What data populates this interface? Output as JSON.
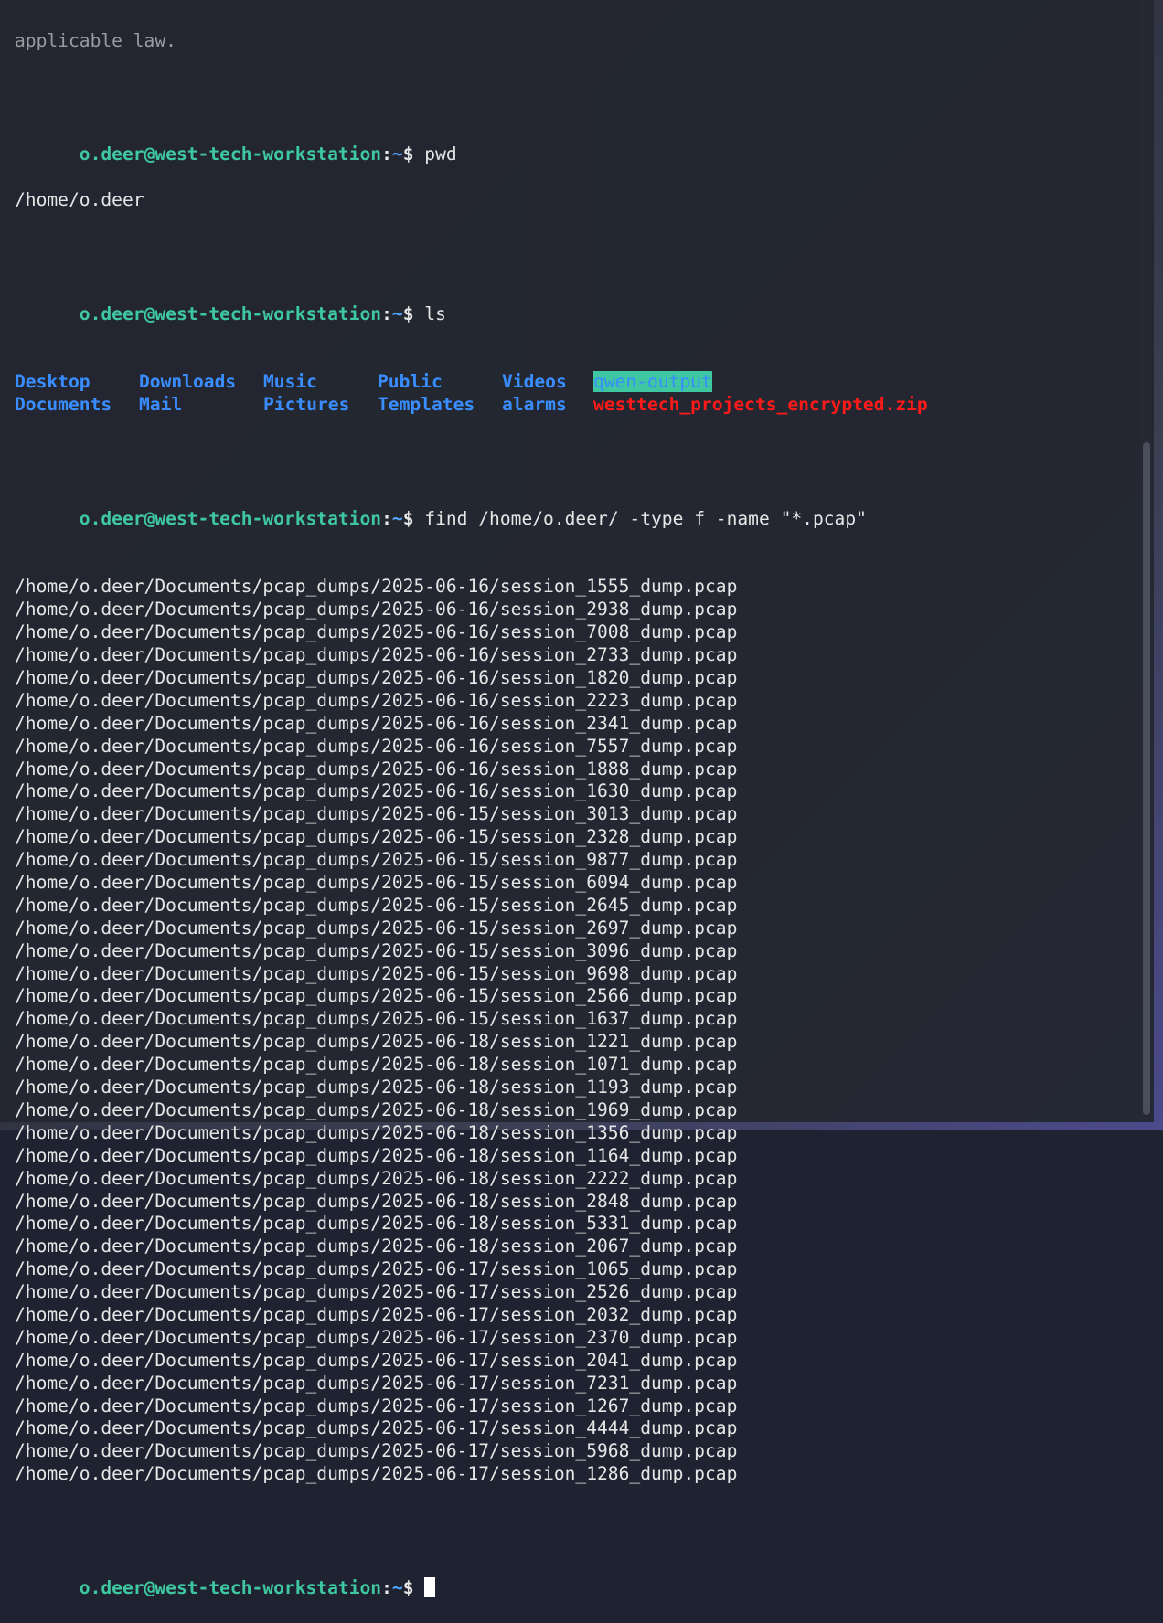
{
  "prompt": {
    "user": "o.deer",
    "at": "@",
    "host": "west-tech-workstation",
    "colon": ":",
    "path": "~",
    "dollar": "$"
  },
  "top_line": "applicable law.",
  "commands": {
    "pwd": " pwd",
    "pwd_output": "/home/o.deer",
    "ls": " ls",
    "find": " find /home/o.deer/ -type f -name \"*.pcap\""
  },
  "ls_output": [
    {
      "name": "Desktop",
      "kind": "dir"
    },
    {
      "name": "Downloads",
      "kind": "dir"
    },
    {
      "name": "Music",
      "kind": "dir"
    },
    {
      "name": "Public",
      "kind": "dir"
    },
    {
      "name": "Videos",
      "kind": "dir"
    },
    {
      "name": "qwen-output",
      "kind": "hl-dir"
    },
    {
      "name": "Documents",
      "kind": "dir"
    },
    {
      "name": "Mail",
      "kind": "dir"
    },
    {
      "name": "Pictures",
      "kind": "dir"
    },
    {
      "name": "Templates",
      "kind": "dir"
    },
    {
      "name": "alarms",
      "kind": "dir"
    },
    {
      "name": "westtech_projects_encrypted.zip",
      "kind": "zip"
    }
  ],
  "find_results": [
    "/home/o.deer/Documents/pcap_dumps/2025-06-16/session_1555_dump.pcap",
    "/home/o.deer/Documents/pcap_dumps/2025-06-16/session_2938_dump.pcap",
    "/home/o.deer/Documents/pcap_dumps/2025-06-16/session_7008_dump.pcap",
    "/home/o.deer/Documents/pcap_dumps/2025-06-16/session_2733_dump.pcap",
    "/home/o.deer/Documents/pcap_dumps/2025-06-16/session_1820_dump.pcap",
    "/home/o.deer/Documents/pcap_dumps/2025-06-16/session_2223_dump.pcap",
    "/home/o.deer/Documents/pcap_dumps/2025-06-16/session_2341_dump.pcap",
    "/home/o.deer/Documents/pcap_dumps/2025-06-16/session_7557_dump.pcap",
    "/home/o.deer/Documents/pcap_dumps/2025-06-16/session_1888_dump.pcap",
    "/home/o.deer/Documents/pcap_dumps/2025-06-16/session_1630_dump.pcap",
    "/home/o.deer/Documents/pcap_dumps/2025-06-15/session_3013_dump.pcap",
    "/home/o.deer/Documents/pcap_dumps/2025-06-15/session_2328_dump.pcap",
    "/home/o.deer/Documents/pcap_dumps/2025-06-15/session_9877_dump.pcap",
    "/home/o.deer/Documents/pcap_dumps/2025-06-15/session_6094_dump.pcap",
    "/home/o.deer/Documents/pcap_dumps/2025-06-15/session_2645_dump.pcap",
    "/home/o.deer/Documents/pcap_dumps/2025-06-15/session_2697_dump.pcap",
    "/home/o.deer/Documents/pcap_dumps/2025-06-15/session_3096_dump.pcap",
    "/home/o.deer/Documents/pcap_dumps/2025-06-15/session_9698_dump.pcap",
    "/home/o.deer/Documents/pcap_dumps/2025-06-15/session_2566_dump.pcap",
    "/home/o.deer/Documents/pcap_dumps/2025-06-15/session_1637_dump.pcap",
    "/home/o.deer/Documents/pcap_dumps/2025-06-18/session_1221_dump.pcap",
    "/home/o.deer/Documents/pcap_dumps/2025-06-18/session_1071_dump.pcap",
    "/home/o.deer/Documents/pcap_dumps/2025-06-18/session_1193_dump.pcap",
    "/home/o.deer/Documents/pcap_dumps/2025-06-18/session_1969_dump.pcap",
    "/home/o.deer/Documents/pcap_dumps/2025-06-18/session_1356_dump.pcap",
    "/home/o.deer/Documents/pcap_dumps/2025-06-18/session_1164_dump.pcap",
    "/home/o.deer/Documents/pcap_dumps/2025-06-18/session_2222_dump.pcap",
    "/home/o.deer/Documents/pcap_dumps/2025-06-18/session_2848_dump.pcap",
    "/home/o.deer/Documents/pcap_dumps/2025-06-18/session_5331_dump.pcap",
    "/home/o.deer/Documents/pcap_dumps/2025-06-18/session_2067_dump.pcap",
    "/home/o.deer/Documents/pcap_dumps/2025-06-17/session_1065_dump.pcap",
    "/home/o.deer/Documents/pcap_dumps/2025-06-17/session_2526_dump.pcap",
    "/home/o.deer/Documents/pcap_dumps/2025-06-17/session_2032_dump.pcap",
    "/home/o.deer/Documents/pcap_dumps/2025-06-17/session_2370_dump.pcap",
    "/home/o.deer/Documents/pcap_dumps/2025-06-17/session_2041_dump.pcap",
    "/home/o.deer/Documents/pcap_dumps/2025-06-17/session_7231_dump.pcap",
    "/home/o.deer/Documents/pcap_dumps/2025-06-17/session_1267_dump.pcap",
    "/home/o.deer/Documents/pcap_dumps/2025-06-17/session_4444_dump.pcap",
    "/home/o.deer/Documents/pcap_dumps/2025-06-17/session_5968_dump.pcap",
    "/home/o.deer/Documents/pcap_dumps/2025-06-17/session_1286_dump.pcap"
  ],
  "colors": {
    "prompt_user": "#3ec7a0",
    "prompt_path": "#4fa8ff",
    "directory": "#3a8dff",
    "highlight_bg": "#3ec7a0",
    "archive": "#ff1a1a",
    "terminal_bg": "#232630"
  }
}
